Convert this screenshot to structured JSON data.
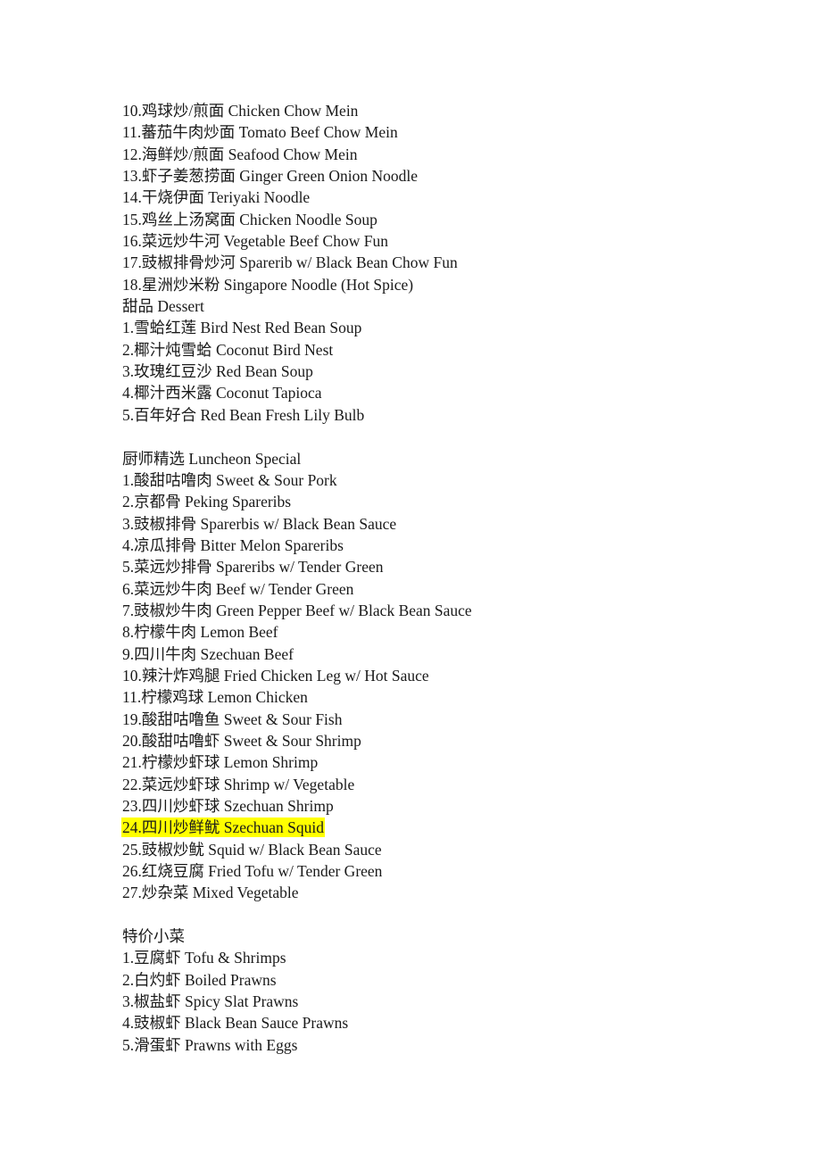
{
  "document": {
    "type": "restaurant-menu-text-listing",
    "background_color": "#ffffff",
    "text_color": "#1a1a1a",
    "highlight_color": "#ffff00",
    "blocks": [
      {
        "id": "noodles-continued",
        "name": "noodle-dishes-continued",
        "lines": [
          {
            "text": "10.鸡球炒/煎面 Chicken Chow Mein",
            "highlight": false
          },
          {
            "text": "11.蕃茄牛肉炒面 Tomato Beef Chow Mein",
            "highlight": false
          },
          {
            "text": "12.海鲜炒/煎面 Seafood Chow Mein",
            "highlight": false
          },
          {
            "text": "13.虾子姜葱捞面 Ginger Green Onion Noodle",
            "highlight": false
          },
          {
            "text": "14.干烧伊面 Teriyaki Noodle",
            "highlight": false
          },
          {
            "text": "15.鸡丝上汤窝面 Chicken Noodle Soup",
            "highlight": false
          },
          {
            "text": "16.菜远炒牛河 Vegetable Beef Chow Fun",
            "highlight": false
          },
          {
            "text": "17.豉椒排骨炒河 Sparerib w/ Black Bean Chow Fun",
            "highlight": false
          },
          {
            "text": "18.星洲炒米粉 Singapore Noodle (Hot Spice)",
            "highlight": false
          }
        ]
      },
      {
        "id": "dessert",
        "name": "dessert-section",
        "lines": [
          {
            "text": "甜品 Dessert",
            "highlight": false
          },
          {
            "text": "1.雪蛤红莲 Bird Nest Red Bean Soup",
            "highlight": false
          },
          {
            "text": "2.椰汁炖雪蛤 Coconut Bird Nest",
            "highlight": false
          },
          {
            "text": "3.玫瑰红豆沙 Red Bean Soup",
            "highlight": false
          },
          {
            "text": "4.椰汁西米露 Coconut Tapioca",
            "highlight": false
          },
          {
            "text": "5.百年好合 Red Bean Fresh Lily Bulb",
            "highlight": false
          }
        ]
      },
      {
        "id": "blank-1",
        "name": "section-spacer",
        "lines": [
          {
            "text": "",
            "highlight": false
          }
        ]
      },
      {
        "id": "luncheon-special",
        "name": "luncheon-special-section",
        "lines": [
          {
            "text": "厨师精选 Luncheon Special",
            "highlight": false
          },
          {
            "text": "1.酸甜咕噜肉 Sweet & Sour Pork",
            "highlight": false
          },
          {
            "text": "2.京都骨 Peking Spareribs",
            "highlight": false
          },
          {
            "text": "3.豉椒排骨 Sparerbis w/ Black Bean Sauce",
            "highlight": false
          },
          {
            "text": "4.凉瓜排骨 Bitter Melon Spareribs",
            "highlight": false
          },
          {
            "text": "5.菜远炒排骨 Spareribs w/ Tender Green",
            "highlight": false
          },
          {
            "text": "6.菜远炒牛肉 Beef w/ Tender Green",
            "highlight": false
          },
          {
            "text": "7.豉椒炒牛肉 Green Pepper Beef w/ Black Bean Sauce",
            "highlight": false
          },
          {
            "text": "8.柠檬牛肉 Lemon Beef",
            "highlight": false
          },
          {
            "text": "9.四川牛肉 Szechuan Beef",
            "highlight": false
          },
          {
            "text": "10.辣汁炸鸡腿 Fried Chicken Leg w/ Hot Sauce",
            "highlight": false
          },
          {
            "text": "11.柠檬鸡球 Lemon Chicken",
            "highlight": false
          },
          {
            "text": "19.酸甜咕噜鱼 Sweet & Sour Fish",
            "highlight": false
          },
          {
            "text": "20.酸甜咕噜虾 Sweet & Sour Shrimp",
            "highlight": false
          },
          {
            "text": "21.柠檬炒虾球 Lemon Shrimp",
            "highlight": false
          },
          {
            "text": "22.菜远炒虾球 Shrimp w/ Vegetable",
            "highlight": false
          },
          {
            "text": "23.四川炒虾球 Szechuan Shrimp",
            "highlight": false
          },
          {
            "text": "24.四川炒鲜鱿 Szechuan Squid",
            "highlight": true
          },
          {
            "text": "25.豉椒炒鱿 Squid w/ Black Bean Sauce",
            "highlight": false
          },
          {
            "text": "26.红烧豆腐 Fried Tofu w/ Tender Green",
            "highlight": false
          },
          {
            "text": "27.炒杂菜 Mixed Vegetable",
            "highlight": false
          }
        ]
      },
      {
        "id": "blank-2",
        "name": "section-spacer",
        "lines": [
          {
            "text": "",
            "highlight": false
          }
        ]
      },
      {
        "id": "special-dishes",
        "name": "special-priced-dishes-section",
        "lines": [
          {
            "text": "特价小菜",
            "highlight": false
          },
          {
            "text": "1.豆腐虾 Tofu & Shrimps",
            "highlight": false
          },
          {
            "text": "2.白灼虾 Boiled Prawns",
            "highlight": false
          },
          {
            "text": "3.椒盐虾 Spicy Slat Prawns",
            "highlight": false
          },
          {
            "text": "4.豉椒虾 Black Bean Sauce Prawns",
            "highlight": false
          },
          {
            "text": "5.滑蛋虾 Prawns with Eggs",
            "highlight": false
          }
        ]
      }
    ]
  }
}
